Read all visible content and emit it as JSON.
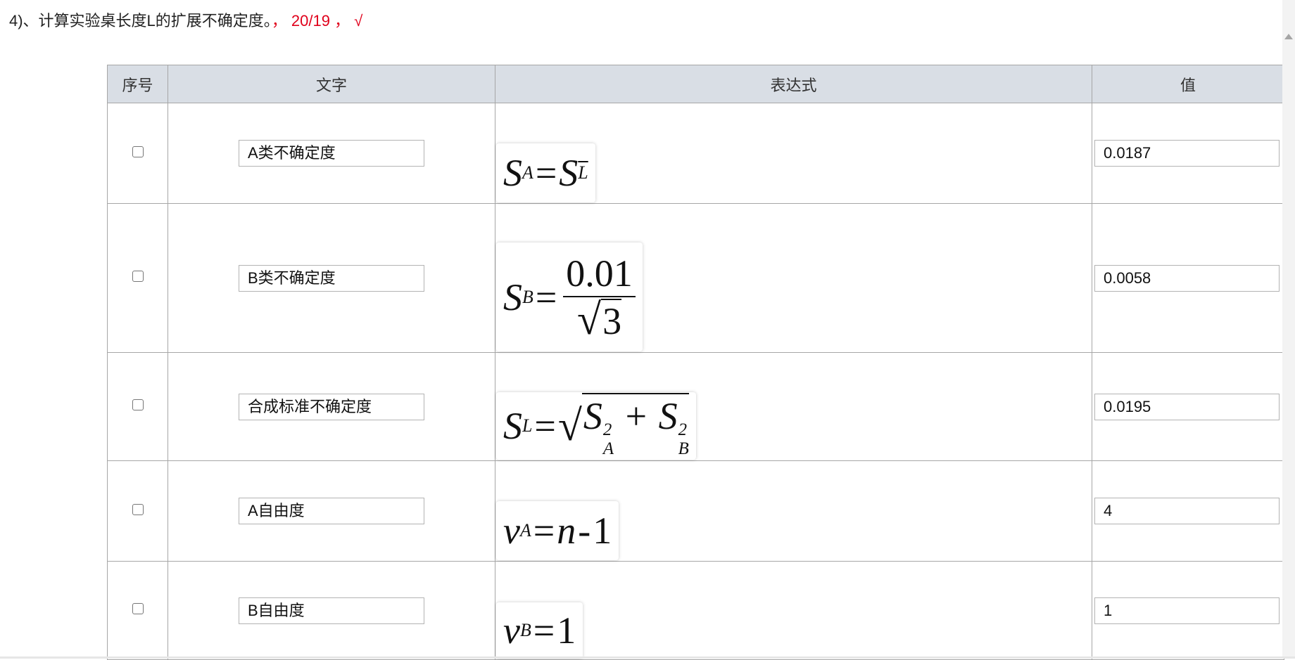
{
  "question": {
    "text": "4)、计算实验桌长度L的扩展不确定度。",
    "score": "， 20/19 ， √"
  },
  "table": {
    "headers": {
      "index": "序号",
      "text": "文字",
      "expression": "表达式",
      "value": "值"
    },
    "rows": [
      {
        "text": "A类不确定度",
        "value": "0.0187"
      },
      {
        "text": "B类不确定度",
        "value": "0.0058"
      },
      {
        "text": "合成标准不确定度",
        "value": "0.0195"
      },
      {
        "text": "A自由度",
        "value": "4"
      },
      {
        "text": "B自由度",
        "value": "1"
      }
    ]
  },
  "formulas": {
    "r1": {
      "lhs": "S",
      "lhs_sub": "A",
      "eq": "=",
      "rhs": "S",
      "rhs_sub": "L"
    },
    "r2": {
      "lhs": "S",
      "lhs_sub": "B",
      "eq": "=",
      "num": "0.01",
      "radical": "√",
      "den": "3"
    },
    "r3": {
      "lhs": "S",
      "lhs_sub": "L",
      "eq": "=",
      "radical": "√",
      "t1": "S",
      "t1_sup": "2",
      "t1_sub": "A",
      "plus": "+",
      "t2": "S",
      "t2_sup": "2",
      "t2_sub": "B"
    },
    "r4": {
      "lhs": "v",
      "lhs_sub": "A",
      "eq": "=",
      "n": "n",
      "minus": "-",
      "one": "1"
    },
    "r5": {
      "lhs": "v",
      "lhs_sub": "B",
      "eq": "=",
      "one": "1"
    }
  }
}
